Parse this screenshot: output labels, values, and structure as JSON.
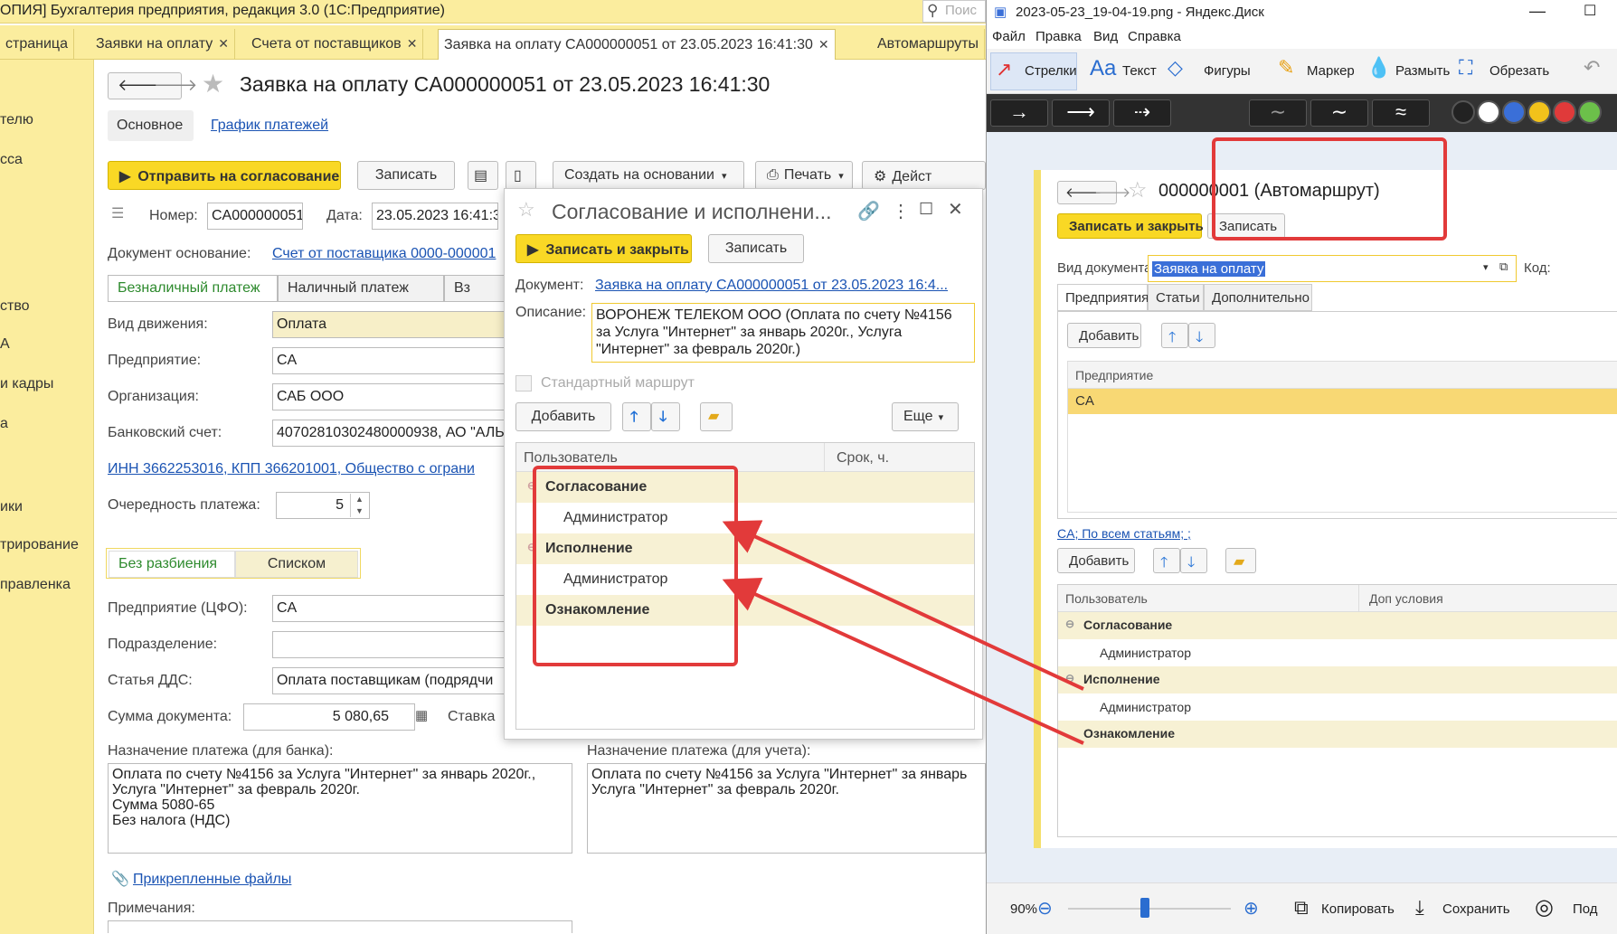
{
  "main": {
    "title": "ОПИЯ] Бухгалтерия предприятия, редакция 3.0  (1С:Предприятие)",
    "search_placeholder": "Поис",
    "tabs": [
      {
        "label": "страница"
      },
      {
        "label": "Заявки на оплату"
      },
      {
        "label": "Счета от поставщиков"
      },
      {
        "label": "Заявка на оплату CA000000051 от 23.05.2023 16:41:30"
      },
      {
        "label": "Автомаршруты"
      }
    ],
    "sidebar": [
      "телю",
      "сса",
      "ство",
      "А",
      "и кадры",
      "а",
      "ики",
      "трирование",
      "правленка"
    ]
  },
  "form": {
    "title": "Заявка на оплату CA000000051 от 23.05.2023 16:41:30",
    "subtabs": {
      "main": "Основное",
      "schedule": "График платежей"
    },
    "toolbar": {
      "send": "Отправить на согласование",
      "save": "Записать",
      "create_based": "Создать на основании",
      "print": "Печать",
      "actions": "Дейст"
    },
    "number_label": "Номер:",
    "number": "CA000000051",
    "date_label": "Дата:",
    "date": "23.05.2023 16:41:3",
    "basis_label": "Документ основание:",
    "basis": "Счет от поставщика 0000-000001",
    "pay_types": [
      "Безналичный платеж",
      "Наличный платеж",
      "Вз"
    ],
    "fields": [
      {
        "label": "Вид движения:",
        "value": "Оплата"
      },
      {
        "label": "Предприятие:",
        "value": "CA"
      },
      {
        "label": "Организация:",
        "value": "САБ ООО"
      },
      {
        "label": "Банковский счет:",
        "value": "40702810302480000938, АО \"АЛЬ"
      }
    ],
    "inn_link": "ИНН 3662253016, КПП 366201001, Общество с ограни",
    "priority_label": "Очередность платежа:",
    "priority": "5",
    "split": [
      "Без разбиения",
      "Списком"
    ],
    "fields2": [
      {
        "label": "Предприятие (ЦФО):",
        "value": "CA"
      },
      {
        "label": "Подразделение:",
        "value": ""
      },
      {
        "label": "Статья ДДС:",
        "value": "Оплата поставщикам (подрядчи"
      }
    ],
    "sum_label": "Сумма документа:",
    "sum": "5 080,65",
    "rate_label": "Ставка",
    "purpose_bank_label": "Назначение платежа (для банка):",
    "purpose_bank": "Оплата по счету №4156 за Услуга \"Интернет\" за январь 2020г.,\nУслуга \"Интернет\" за февраль 2020г.\nСумма 5080-65\nБез налога (НДС)",
    "purpose_acc_label": "Назначение платежа (для учета):",
    "purpose_acc": "Оплата по счету №4156 за Услуга \"Интернет\" за январь\nУслуга \"Интернет\" за февраль 2020г.",
    "files": "Прикрепленные файлы",
    "notes_label": "Примечания:"
  },
  "dialog": {
    "title": "Согласование и исполнени...",
    "save_close": "Записать и закрыть",
    "save": "Записать",
    "doc_label": "Документ:",
    "doc": "Заявка на оплату CA000000051 от 23.05.2023 16:4...",
    "desc_label": "Описание:",
    "desc": "ВОРОНЕЖ ТЕЛЕКОМ ООО (Оплата по счету №4156\nза Услуга \"Интернет\" за январь 2020г., Услуга\n\"Интернет\" за февраль 2020г.)",
    "std_route": "Стандартный маршрут",
    "add": "Добавить",
    "more": "Еще",
    "col_user": "Пользователь",
    "col_term": "Срок, ч.",
    "rows": [
      {
        "text": "Согласование",
        "group": true
      },
      {
        "text": "Администратор",
        "group": false
      },
      {
        "text": "Исполнение",
        "group": true
      },
      {
        "text": "Администратор",
        "group": false
      },
      {
        "text": "Ознакомление",
        "group": true
      }
    ]
  },
  "viewer": {
    "title": "2023-05-23_19-04-19.png - Яндекс.Диск",
    "menu": [
      "Файл",
      "Правка",
      "Вид",
      "Справка"
    ],
    "tools": [
      "Стрелки",
      "Текст",
      "Фигуры",
      "Маркер",
      "Размыть",
      "Обрезать"
    ],
    "colors": [
      "#222222",
      "#ffffff",
      "#3a6fd8",
      "#f2c21b",
      "#e03a3a",
      "#6cc04a"
    ],
    "inner": {
      "title": "000000001 (Автомаршрут)",
      "save_close": "Записать и закрыть",
      "save": "Записать",
      "doc_type_label": "Вид документа:",
      "doc_type": "Заявка на оплату",
      "code_label": "Код:",
      "tabs": [
        "Предприятия",
        "Статьи",
        "Дополнительно"
      ],
      "add": "Добавить",
      "col_enterprise": "Предприятие",
      "enterprise_row": "CA",
      "summary_link": "CA; По всем статьям; ;",
      "add2": "Добавить",
      "col_user": "Пользователь",
      "col_cond": "Доп условия",
      "rows": [
        {
          "text": "Согласование",
          "group": true
        },
        {
          "text": "Администратор",
          "group": false
        },
        {
          "text": "Исполнение",
          "group": true
        },
        {
          "text": "Администратор",
          "group": false
        },
        {
          "text": "Ознакомление",
          "group": true
        }
      ]
    },
    "zoom": "90%",
    "copy": "Копировать",
    "save": "Сохранить",
    "share": "Под"
  }
}
